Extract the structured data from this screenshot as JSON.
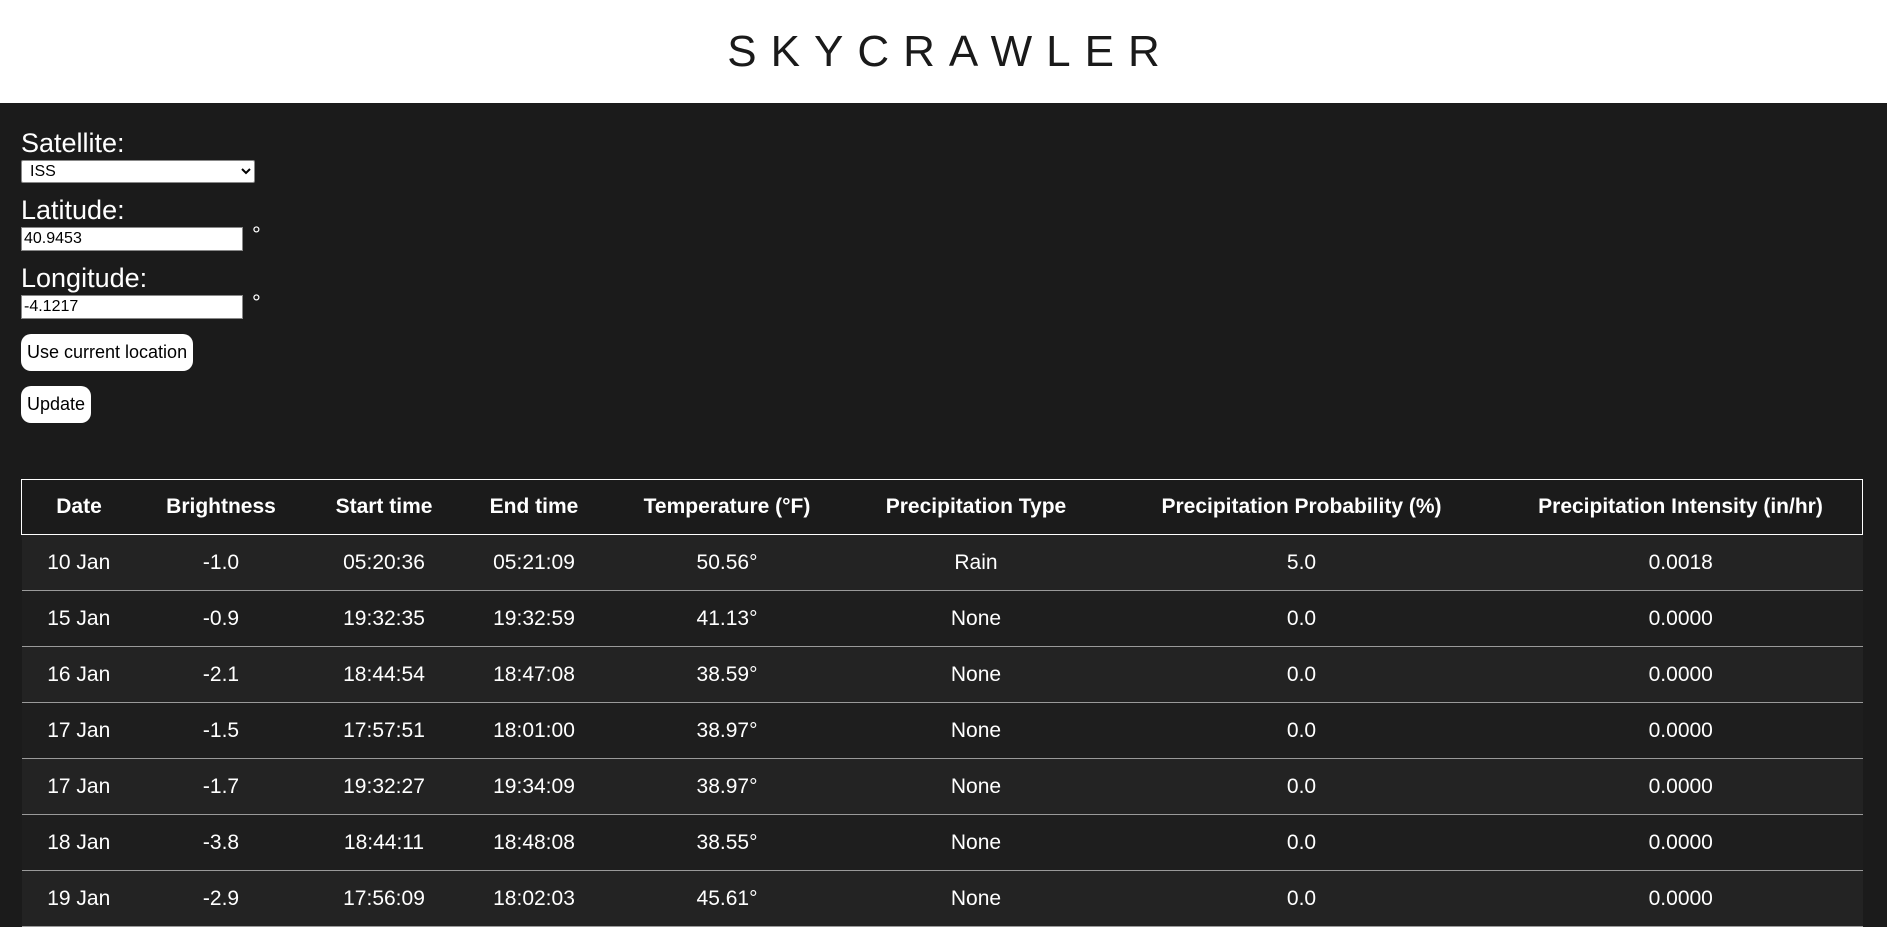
{
  "app": {
    "title": "SKYCRAWLER"
  },
  "form": {
    "satellite_label": "Satellite:",
    "satellite_value": "ISS",
    "latitude_label": "Latitude:",
    "latitude_value": "40.9453",
    "longitude_label": "Longitude:",
    "longitude_value": "-4.1217",
    "degree_symbol": "°",
    "current_location_button": "Use current location",
    "update_button": "Update"
  },
  "table": {
    "headers": [
      "Date",
      "Brightness",
      "Start time",
      "End time",
      "Temperature (°F)",
      "Precipitation Type",
      "Precipitation Probability (%)",
      "Precipitation Intensity (in/hr)"
    ],
    "rows": [
      [
        "10 Jan",
        "-1.0",
        "05:20:36",
        "05:21:09",
        "50.56°",
        "Rain",
        "5.0",
        "0.0018"
      ],
      [
        "15 Jan",
        "-0.9",
        "19:32:35",
        "19:32:59",
        "41.13°",
        "None",
        "0.0",
        "0.0000"
      ],
      [
        "16 Jan",
        "-2.1",
        "18:44:54",
        "18:47:08",
        "38.59°",
        "None",
        "0.0",
        "0.0000"
      ],
      [
        "17 Jan",
        "-1.5",
        "17:57:51",
        "18:01:00",
        "38.97°",
        "None",
        "0.0",
        "0.0000"
      ],
      [
        "17 Jan",
        "-1.7",
        "19:32:27",
        "19:34:09",
        "38.97°",
        "None",
        "0.0",
        "0.0000"
      ],
      [
        "18 Jan",
        "-3.8",
        "18:44:11",
        "18:48:08",
        "38.55°",
        "None",
        "0.0",
        "0.0000"
      ],
      [
        "19 Jan",
        "-2.9",
        "17:56:09",
        "18:02:03",
        "45.61°",
        "None",
        "0.0",
        "0.0000"
      ]
    ]
  }
}
